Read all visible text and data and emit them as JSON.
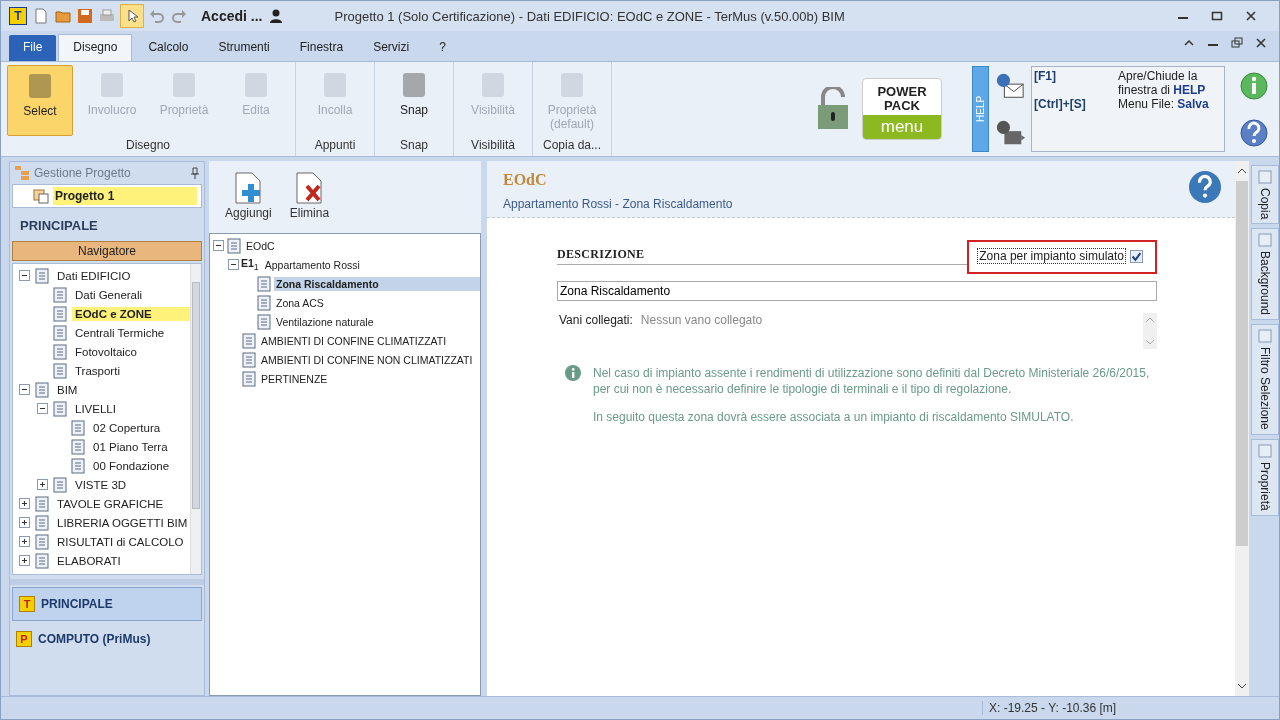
{
  "window": {
    "app_logo": "T",
    "account": "Accedi ...",
    "title": "Progetto 1 (Solo Certificazione) -  Dati EDIFICIO: EOdC e ZONE - TerMus (v.50.00b) BIM"
  },
  "menu_tabs": [
    {
      "label": "File",
      "kind": "file",
      "selected": false
    },
    {
      "label": "Disegno",
      "kind": "tab",
      "selected": true
    },
    {
      "label": "Calcolo",
      "kind": "tab",
      "selected": false
    },
    {
      "label": "Strumenti",
      "kind": "tab",
      "selected": false
    },
    {
      "label": "Finestra",
      "kind": "tab",
      "selected": false
    },
    {
      "label": "Servizi",
      "kind": "tab",
      "selected": false
    },
    {
      "label": "?",
      "kind": "tab",
      "selected": false
    }
  ],
  "ribbon": {
    "groups": [
      {
        "label": "Disegno",
        "buttons": [
          {
            "label": "Select",
            "selected": true,
            "disabled": false
          },
          {
            "label": "Involucro",
            "selected": false,
            "disabled": true
          },
          {
            "label": "Proprietà",
            "selected": false,
            "disabled": true
          },
          {
            "label": "Edita",
            "selected": false,
            "disabled": true
          }
        ]
      },
      {
        "label": "Appunti",
        "buttons": [
          {
            "label": "Incolla",
            "selected": false,
            "disabled": true
          }
        ]
      },
      {
        "label": "Snap",
        "buttons": [
          {
            "label": "Snap",
            "selected": false,
            "disabled": false
          }
        ]
      },
      {
        "label": "Visibilità",
        "buttons": [
          {
            "label": "Visibilità",
            "selected": false,
            "disabled": true
          }
        ]
      },
      {
        "label": "Copia da...",
        "buttons": [
          {
            "label": "Proprietà (default)",
            "selected": false,
            "disabled": true
          }
        ]
      }
    ]
  },
  "power_pack": {
    "logo_top": "POWER",
    "logo_bottom": "PACK",
    "label": "menu"
  },
  "help": {
    "tab": "HELP",
    "shortcuts": [
      {
        "key": "[F1]",
        "text": "Apre/Chiude la finestra di **HELP**"
      },
      {
        "key": "[Ctrl]+[S]",
        "text": "Menu File: **Salva**"
      }
    ]
  },
  "project_panel": {
    "title": "Gestione Progetto",
    "project": "Progetto 1",
    "section": "PRINCIPALE",
    "navigator": "Navigatore",
    "tree": [
      {
        "label": "Dati EDIFICIO",
        "expanded": true,
        "selected": false,
        "children": [
          {
            "label": "Dati Generali",
            "selected": false
          },
          {
            "label": "EOdC e ZONE",
            "selected": true
          },
          {
            "label": "Centrali Termiche",
            "selected": false
          },
          {
            "label": "Fotovoltaico",
            "selected": false
          },
          {
            "label": "Trasporti",
            "selected": false
          }
        ]
      },
      {
        "label": "BIM",
        "expanded": true,
        "selected": false,
        "children": [
          {
            "label": "LIVELLI",
            "expanded": true,
            "selected": false,
            "children": [
              {
                "label": "02 Copertura",
                "selected": false
              },
              {
                "label": "01 Piano Terra",
                "selected": false
              },
              {
                "label": "00 Fondazione",
                "selected": false
              }
            ]
          },
          {
            "label": "VISTE 3D",
            "expanded": false,
            "selected": false
          }
        ]
      },
      {
        "label": "TAVOLE GRAFICHE",
        "expanded": false,
        "selected": false
      },
      {
        "label": "LIBRERIA OGGETTI BIM",
        "expanded": false,
        "selected": false
      },
      {
        "label": "RISULTATI di CALCOLO",
        "expanded": false,
        "selected": false
      },
      {
        "label": "ELABORATI",
        "expanded": false,
        "selected": false
      }
    ]
  },
  "modules": [
    {
      "badge": "T",
      "label": "PRINCIPALE",
      "selected": true
    },
    {
      "badge": "P",
      "label": "COMPUTO (PriMus)",
      "selected": false
    }
  ],
  "zone_panel": {
    "actions": [
      "Aggiungi",
      "Elimina"
    ],
    "tree": [
      {
        "label": "EOdC",
        "expanded": true,
        "selected": false,
        "children": [
          {
            "prefix": "**E1**$_{1}$",
            "label": "Appartamento Rossi",
            "expanded": true,
            "selected": false,
            "children": [
              {
                "label": "Zona Riscaldamento",
                "selected": true
              },
              {
                "label": "Zona ACS",
                "selected": false
              },
              {
                "label": "Ventilazione naturale",
                "selected": false
              }
            ]
          },
          {
            "label": "AMBIENTI DI CONFINE CLIMATIZZATI",
            "selected": false
          },
          {
            "label": "AMBIENTI DI CONFINE NON CLIMATIZZATI",
            "selected": false
          },
          {
            "label": "PERTINENZE",
            "selected": false
          }
        ]
      }
    ]
  },
  "detail": {
    "title": "EOdC",
    "subtitle": "Appartamento Rossi - Zona Riscaldamento",
    "section": "DESCRIZIONE",
    "simulated": {
      "label": "Zona per impianto simulato",
      "checked": true,
      "highlighted": true
    },
    "name_value": "Zona Riscaldamento",
    "linked": {
      "label": "Vani collegati:",
      "value": "Nessun vano collegato"
    },
    "notes": [
      "Nel caso di impianto assente i rendimenti di utilizzazione sono definiti dal Decreto Ministeriale 26/6/2015, per cui non è necessario definire le tipologie di terminali e il tipo di regolazione.",
      "In seguito questa zona dovrà essere associata a un impianto di riscaldamento SIMULATO."
    ]
  },
  "side_tabs": [
    "Copia",
    "Background",
    "Filtro Selezione",
    "Proprietà"
  ],
  "status_bar": {
    "coordinates": "X: -19.25 - Y: -10.36 [m]"
  }
}
